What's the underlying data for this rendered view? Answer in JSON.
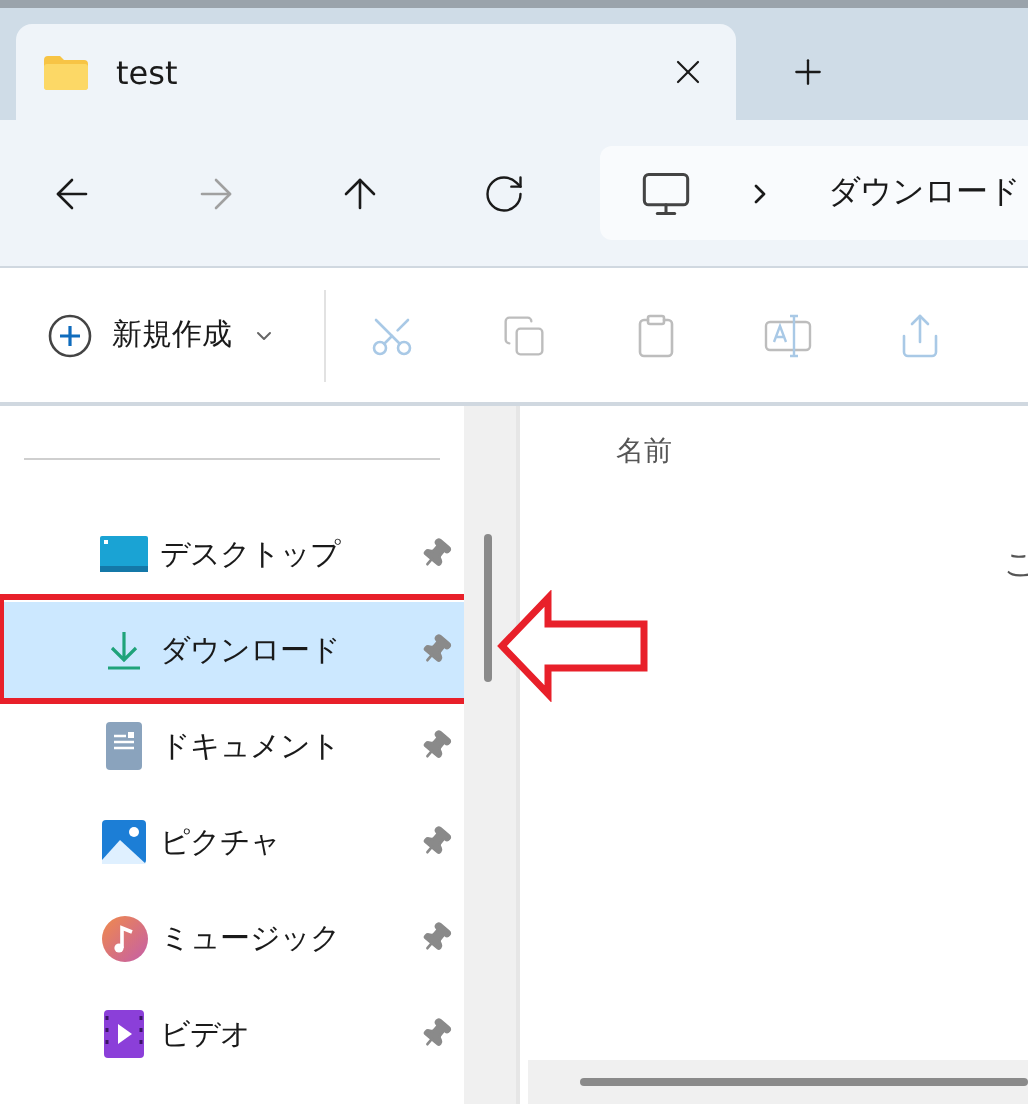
{
  "tab": {
    "title": "test",
    "selected": true
  },
  "nav": {
    "back_disabled": false,
    "forward_disabled": true,
    "up_disabled": false
  },
  "address": {
    "crumbs": [
      "ダウンロード"
    ]
  },
  "toolbar": {
    "new_button": "新規作成",
    "actions": [
      {
        "kind": "cut",
        "disabled": true
      },
      {
        "kind": "copy",
        "disabled": true
      },
      {
        "kind": "paste",
        "disabled": true
      },
      {
        "kind": "rename",
        "disabled": true
      },
      {
        "kind": "share",
        "disabled": true
      }
    ]
  },
  "sidebar": {
    "items": [
      {
        "kind": "desktop",
        "label": "デスクトップ",
        "selected": false,
        "pinned": true,
        "annotated": false
      },
      {
        "kind": "download",
        "label": "ダウンロード",
        "selected": true,
        "pinned": true,
        "annotated": true
      },
      {
        "kind": "documents",
        "label": "ドキュメント",
        "selected": false,
        "pinned": true,
        "annotated": false
      },
      {
        "kind": "pictures",
        "label": "ピクチャ",
        "selected": false,
        "pinned": true,
        "annotated": false
      },
      {
        "kind": "music",
        "label": "ミュージック",
        "selected": false,
        "pinned": true,
        "annotated": false
      },
      {
        "kind": "videos",
        "label": "ビデオ",
        "selected": false,
        "pinned": true,
        "annotated": false
      }
    ]
  },
  "content": {
    "column_header": "名前",
    "empty_message": "こ"
  }
}
